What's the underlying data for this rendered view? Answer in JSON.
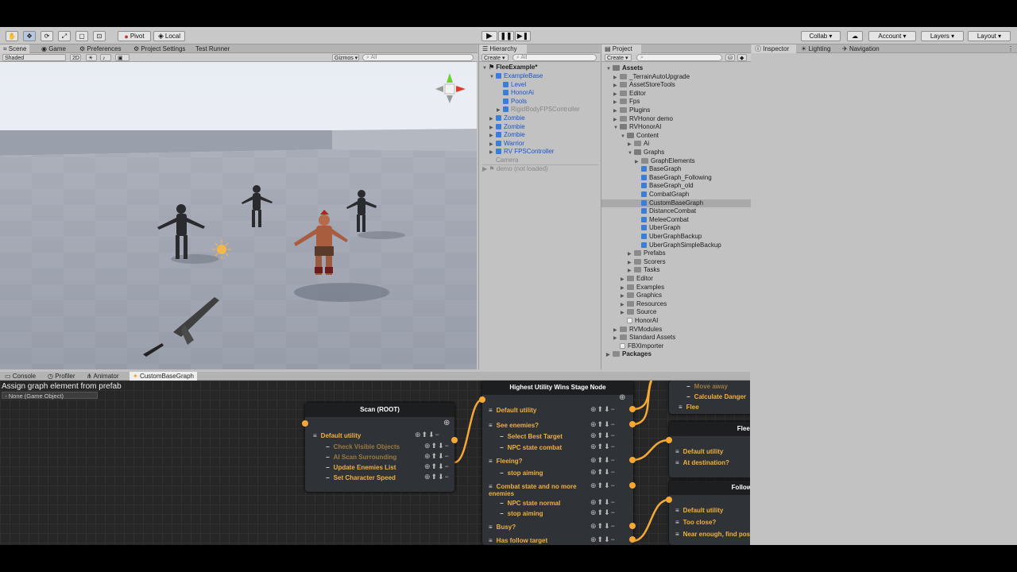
{
  "toolbar": {
    "tools": [
      "hand-icon",
      "move-icon",
      "rotate-icon",
      "scale-icon",
      "rect-icon",
      "transform-icon"
    ],
    "pivot": "Pivot",
    "local": "Local",
    "collab": "Collab ▾",
    "account": "Account",
    "layers": "Layers",
    "layout": "Layout"
  },
  "scene": {
    "tabs": [
      "Scene",
      "Game",
      "Preferences",
      "Project Settings",
      "Test Runner"
    ],
    "shading": "Shaded",
    "mode2d": "2D",
    "gizmos": "Gizmos",
    "search_placeholder": "All"
  },
  "hierarchy": {
    "tab": "Hierarchy",
    "create": "Create",
    "search_placeholder": "All",
    "scene": "FleeExample*",
    "items": [
      {
        "label": "ExampleBase",
        "indent": 1,
        "arrow": "▼",
        "color": "blue",
        "icon": "cube"
      },
      {
        "label": "Level",
        "indent": 2,
        "arrow": "",
        "color": "blue",
        "icon": "cube"
      },
      {
        "label": "HonorAi",
        "indent": 2,
        "arrow": "",
        "color": "blue",
        "icon": "cube"
      },
      {
        "label": "Pools",
        "indent": 2,
        "arrow": "",
        "color": "blue",
        "icon": "cube"
      },
      {
        "label": "RigidBodyFPSController",
        "indent": 2,
        "arrow": "▶",
        "color": "grey",
        "icon": "cube"
      },
      {
        "label": "Zombie",
        "indent": 1,
        "arrow": "▶",
        "color": "blue",
        "icon": "cube"
      },
      {
        "label": "Zombie",
        "indent": 1,
        "arrow": "▶",
        "color": "blue",
        "icon": "cube"
      },
      {
        "label": "Zombie",
        "indent": 1,
        "arrow": "▶",
        "color": "blue",
        "icon": "cube"
      },
      {
        "label": "Warrior",
        "indent": 1,
        "arrow": "▶",
        "color": "blue",
        "icon": "cube"
      },
      {
        "label": "RV FPSController",
        "indent": 1,
        "arrow": "▶",
        "color": "blue",
        "icon": "cube"
      },
      {
        "label": "Camera",
        "indent": 1,
        "arrow": "",
        "color": "grey",
        "icon": "none"
      }
    ],
    "demo": "demo (not loaded)"
  },
  "project": {
    "tab": "Project",
    "create": "Create",
    "items": [
      {
        "label": "Assets",
        "indent": 0,
        "arrow": "▼",
        "icon": "folder",
        "bold": true
      },
      {
        "label": "_TerrainAutoUpgrade",
        "indent": 1,
        "arrow": "▶",
        "icon": "folder"
      },
      {
        "label": "AssetStoreTools",
        "indent": 1,
        "arrow": "▶",
        "icon": "folder"
      },
      {
        "label": "Editor",
        "indent": 1,
        "arrow": "▶",
        "icon": "folder"
      },
      {
        "label": "Fps",
        "indent": 1,
        "arrow": "▶",
        "icon": "folder"
      },
      {
        "label": "Plugins",
        "indent": 1,
        "arrow": "▶",
        "icon": "folder"
      },
      {
        "label": "RVHonor demo",
        "indent": 1,
        "arrow": "▶",
        "icon": "folder"
      },
      {
        "label": "RVHonorAI",
        "indent": 1,
        "arrow": "▼",
        "icon": "folder"
      },
      {
        "label": "Content",
        "indent": 2,
        "arrow": "▼",
        "icon": "folder"
      },
      {
        "label": "Ai",
        "indent": 3,
        "arrow": "▶",
        "icon": "folder"
      },
      {
        "label": "Graphs",
        "indent": 3,
        "arrow": "▼",
        "icon": "folder"
      },
      {
        "label": "GraphElements",
        "indent": 4,
        "arrow": "▶",
        "icon": "folder"
      },
      {
        "label": "BaseGraph",
        "indent": 4,
        "arrow": "",
        "icon": "asset"
      },
      {
        "label": "BaseGraph_Following",
        "indent": 4,
        "arrow": "",
        "icon": "asset"
      },
      {
        "label": "BaseGraph_old",
        "indent": 4,
        "arrow": "",
        "icon": "asset"
      },
      {
        "label": "CombatGraph",
        "indent": 4,
        "arrow": "",
        "icon": "asset"
      },
      {
        "label": "CustomBaseGraph",
        "indent": 4,
        "arrow": "",
        "icon": "asset",
        "selected": true
      },
      {
        "label": "DistanceCombat",
        "indent": 4,
        "arrow": "",
        "icon": "asset"
      },
      {
        "label": "MeleeCombat",
        "indent": 4,
        "arrow": "",
        "icon": "asset"
      },
      {
        "label": "UberGraph",
        "indent": 4,
        "arrow": "",
        "icon": "asset"
      },
      {
        "label": "UberGraphBackup",
        "indent": 4,
        "arrow": "",
        "icon": "asset"
      },
      {
        "label": "UberGraphSimpleBackup",
        "indent": 4,
        "arrow": "",
        "icon": "asset"
      },
      {
        "label": "Prefabs",
        "indent": 3,
        "arrow": "▶",
        "icon": "folder"
      },
      {
        "label": "Scorers",
        "indent": 3,
        "arrow": "▶",
        "icon": "folder"
      },
      {
        "label": "Tasks",
        "indent": 3,
        "arrow": "▶",
        "icon": "folder"
      },
      {
        "label": "Editor",
        "indent": 2,
        "arrow": "▶",
        "icon": "folder"
      },
      {
        "label": "Examples",
        "indent": 2,
        "arrow": "▶",
        "icon": "folder"
      },
      {
        "label": "Graphics",
        "indent": 2,
        "arrow": "▶",
        "icon": "folder"
      },
      {
        "label": "Resources",
        "indent": 2,
        "arrow": "▶",
        "icon": "folder"
      },
      {
        "label": "Source",
        "indent": 2,
        "arrow": "▶",
        "icon": "folder"
      },
      {
        "label": "HonorAI",
        "indent": 2,
        "arrow": "",
        "icon": "file"
      },
      {
        "label": "RVModules",
        "indent": 1,
        "arrow": "▶",
        "icon": "folder"
      },
      {
        "label": "Standard Assets",
        "indent": 1,
        "arrow": "▶",
        "icon": "folder"
      },
      {
        "label": "FBXImporter",
        "indent": 1,
        "arrow": "",
        "icon": "file"
      },
      {
        "label": "Packages",
        "indent": 0,
        "arrow": "▶",
        "icon": "folder",
        "bold": true
      }
    ]
  },
  "inspector": {
    "tabs": [
      "Inspector",
      "Lighting",
      "Navigation"
    ]
  },
  "bottom": {
    "tabs": [
      "Console",
      "Profiler",
      "Animator",
      "CustomBaseGraph"
    ],
    "assign_label": "Assign graph element from prefab",
    "object_field": "None (Game Object)"
  },
  "graph": {
    "scan_node": {
      "title": "Scan (ROOT)",
      "rows": [
        {
          "label": "Default utility",
          "dim": false
        },
        {
          "label": "Check Visible Objects",
          "dim": true
        },
        {
          "label": "AI Scan Surrounding",
          "dim": true
        },
        {
          "label": "Update Enemies List",
          "dim": false
        },
        {
          "label": "Set Character Speed",
          "dim": false
        }
      ]
    },
    "hu_node": {
      "title": "Highest Utility Wins Stage Node",
      "rows": [
        {
          "label": "Default utility",
          "sub": false
        },
        {
          "label": "See enemies?",
          "sub": false
        },
        {
          "label": "Select Best Target",
          "sub": true
        },
        {
          "label": "NPC state combat",
          "sub": true
        },
        {
          "label": "Fleeing?",
          "sub": false
        },
        {
          "label": "stop aiming",
          "sub": true
        },
        {
          "label": "Combat state and no more enemies",
          "sub": false
        },
        {
          "label": "NPC state normal",
          "sub": true
        },
        {
          "label": "stop aiming",
          "sub": true
        },
        {
          "label": "Busy?",
          "sub": false
        },
        {
          "label": "Has follow target",
          "sub": false
        }
      ]
    },
    "right_top_rows": [
      "Move away",
      "Calculate Danger",
      "Flee"
    ],
    "fleeing_node": {
      "title": "Fleei",
      "rows": [
        "Default utility",
        "At destination?"
      ]
    },
    "follow_node": {
      "title": "Follow",
      "rows": [
        "Default utility",
        "Too close?",
        "Near enough, find pos"
      ]
    }
  }
}
